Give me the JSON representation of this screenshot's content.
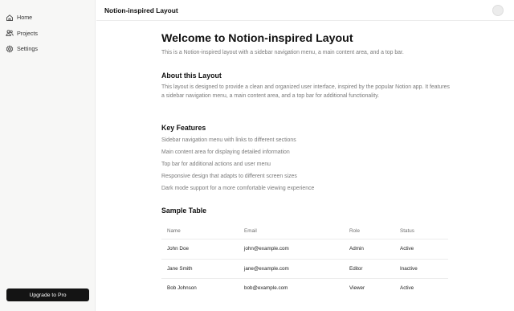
{
  "app": {
    "title": "Notion-inspired Layout"
  },
  "sidebar": {
    "items": [
      {
        "label": "Home",
        "icon": "home-icon"
      },
      {
        "label": "Projects",
        "icon": "users-icon"
      },
      {
        "label": "Settings",
        "icon": "gear-icon"
      }
    ],
    "upgrade_label": "Upgrade to Pro"
  },
  "main": {
    "title": "Welcome to Notion-inspired Layout",
    "intro": "This is a Notion-inspired layout with a sidebar navigation menu, a main content area, and a top bar.",
    "about": {
      "heading": "About this Layout",
      "text": "This layout is designed to provide a clean and organized user interface, inspired by the popular Notion app. It features a sidebar navigation menu, a main content area, and a top bar for additional functionality."
    },
    "features": {
      "heading": "Key Features",
      "items": [
        "Sidebar navigation menu with links to different sections",
        "Main content area for displaying detailed information",
        "Top bar for additional actions and user menu",
        "Responsive design that adapts to different screen sizes",
        "Dark mode support for a more comfortable viewing experience"
      ]
    },
    "table": {
      "heading": "Sample Table",
      "columns": [
        "Name",
        "Email",
        "Role",
        "Status"
      ],
      "rows": [
        [
          "John Doe",
          "john@example.com",
          "Admin",
          "Active"
        ],
        [
          "Jane Smith",
          "jane@example.com",
          "Editor",
          "Inactive"
        ],
        [
          "Bob Johnson",
          "bob@example.com",
          "Viewer",
          "Active"
        ]
      ]
    }
  },
  "colors": {
    "sidebar_bg": "#f7f7f6",
    "button_bg": "#141414",
    "muted_text": "#7a7a7a"
  }
}
